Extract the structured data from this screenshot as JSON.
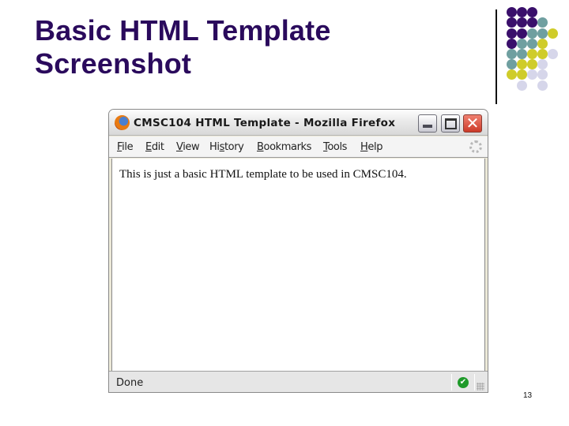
{
  "slide": {
    "title_lines": [
      "Basic HTML Template",
      "Screenshot"
    ],
    "page_number": "13",
    "colors": {
      "title": "#2a0a5c",
      "purple": "#3a0f6b",
      "teal": "#6f9fa0",
      "yellow": "#cfcc2a",
      "lavender": "#d6d6ea"
    },
    "dot_grid": [
      [
        "purple",
        "purple",
        "purple",
        null,
        null
      ],
      [
        "purple",
        "purple",
        "purple",
        "teal",
        null
      ],
      [
        "purple",
        "purple",
        "teal",
        "teal",
        "yellow"
      ],
      [
        "purple",
        "teal",
        "teal",
        "yellow",
        null
      ],
      [
        "teal",
        "teal",
        "yellow",
        "yellow",
        "lavender"
      ],
      [
        "teal",
        "yellow",
        "yellow",
        "lavender",
        null
      ],
      [
        "yellow",
        "yellow",
        "lavender",
        "lavender",
        null
      ],
      [
        null,
        "lavender",
        null,
        "lavender",
        null
      ]
    ]
  },
  "browser": {
    "window_title": "CMSC104 HTML Template - Mozilla Firefox",
    "app_icon": "firefox-icon",
    "controls": {
      "minimize": "minimize-icon",
      "maximize": "maximize-icon",
      "close": "close-icon",
      "close_glyph": "✕"
    },
    "menu": [
      {
        "label": "File",
        "accel": "F"
      },
      {
        "label": "Edit",
        "accel": "E"
      },
      {
        "label": "View",
        "accel": "V"
      },
      {
        "label": "History",
        "accel": "s"
      },
      {
        "label": "Bookmarks",
        "accel": "B"
      },
      {
        "label": "Tools",
        "accel": "T"
      },
      {
        "label": "Help",
        "accel": "H"
      }
    ],
    "page_content": "This is just a basic HTML template to be used in CMSC104.",
    "status": {
      "text": "Done",
      "security_glyph": "✔"
    }
  }
}
